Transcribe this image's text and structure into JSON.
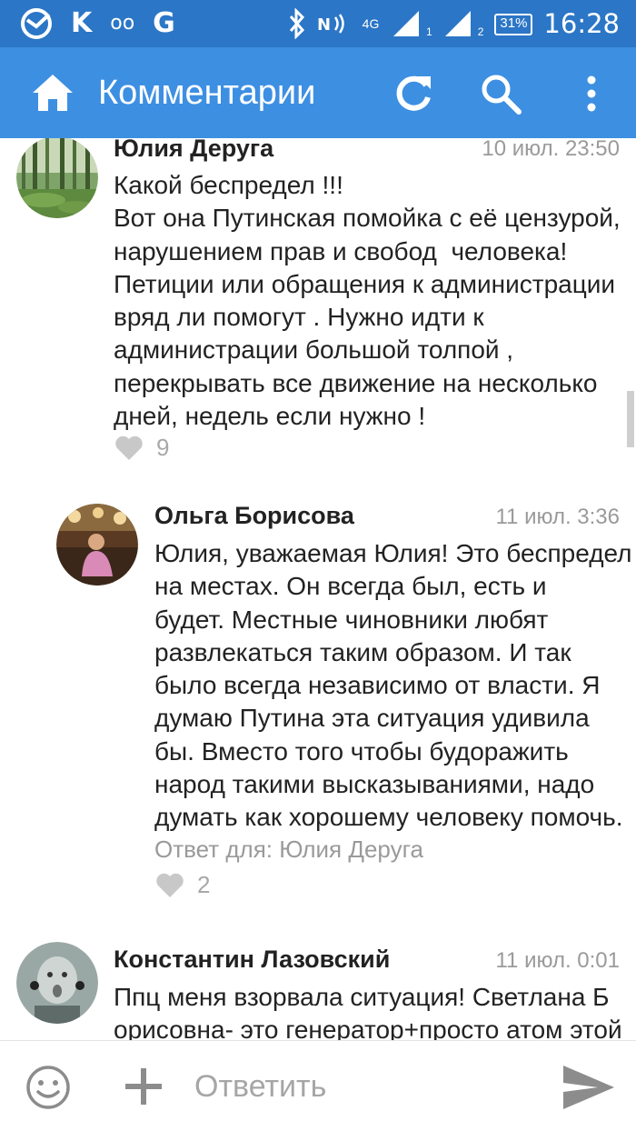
{
  "status_bar": {
    "left_icons": [
      "sberbank-icon",
      "k-icon",
      "voicemail-icon",
      "g-icon"
    ],
    "k_label": "K",
    "voicemail_label": "oo",
    "g_label": "G",
    "network_label": "4G",
    "sim1_label": "1",
    "sim2_label": "2",
    "battery": "31%",
    "time": "16:28"
  },
  "app_bar": {
    "title": "Комментарии",
    "color": "#3d8fe2",
    "status_color": "#2b76c6"
  },
  "comments": [
    {
      "author": "Юлия Деруга",
      "date": "10 июл. 23:50",
      "text": "Какой беспредел !!!\nВот она Путинская помойка с её цензурой,\nнарушением прав и свобод  человека!\nПетиции или обращения к администрации\nвряд ли помогут . Нужно идти к\nадминистрации большой толпой ,\nперекрывать все движение на несколько\nдней, недель если нужно !",
      "likes": "9"
    },
    {
      "author": "Ольга Борисова",
      "date": "11 июл. 3:36",
      "text": "Юлия, уважаемая Юлия! Это беспредел\nна местах. Он всегда был, есть и\nбудет. Местные чиновники любят\nразвлекаться таким образом. И так\nбыло всегда независимо от власти. Я\nдумаю Путина эта ситуация удивила\nбы. Вместо того чтобы будоражить\nнарод такими высказываниями, надо\nдумать как хорошему человеку помочь.",
      "reply_to": "Ответ для: Юлия Деруга",
      "likes": "2"
    },
    {
      "author": "Константин Лазовский",
      "date": "11 июл. 0:01",
      "text": "Ппц меня взорвала ситуация! Светлана Б\nорисовна- это генератор+просто атом этой"
    }
  ],
  "reply_bar": {
    "placeholder": "Ответить"
  }
}
